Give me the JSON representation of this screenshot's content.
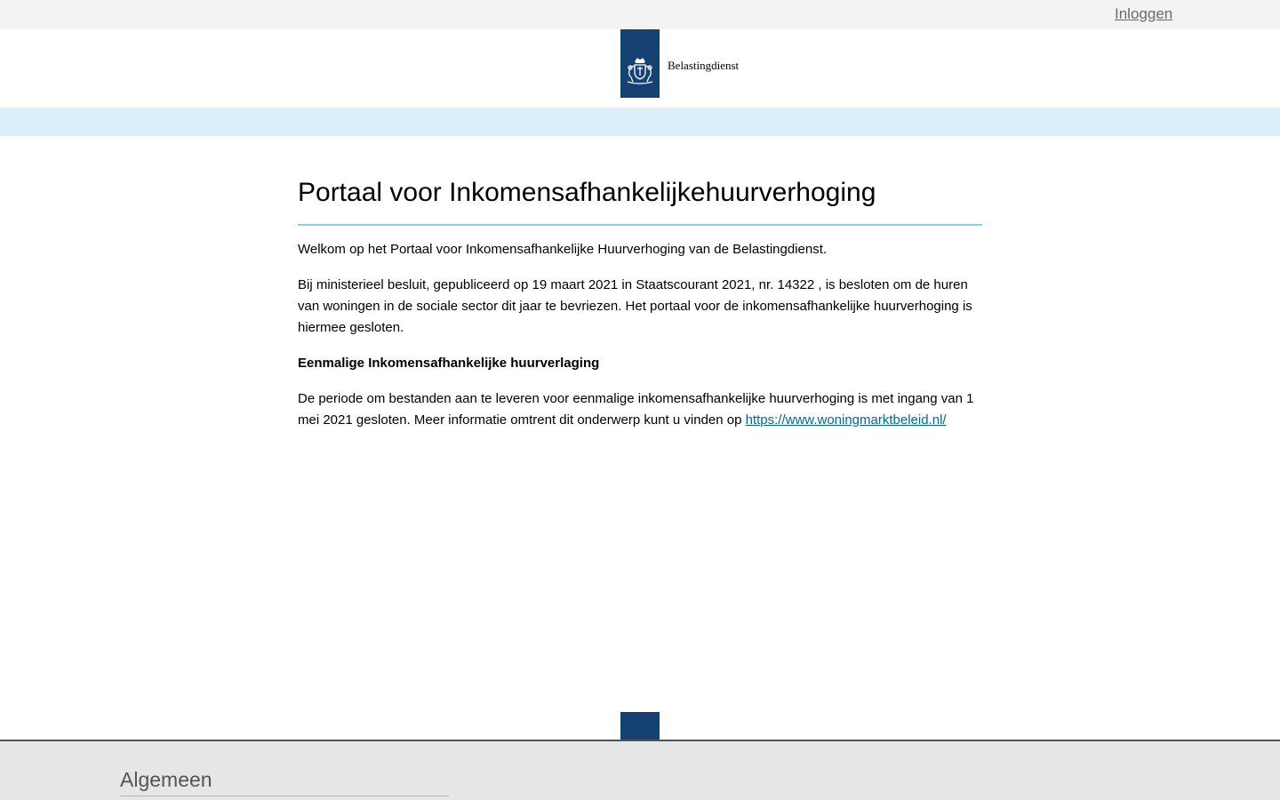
{
  "header": {
    "login_label": "Inloggen",
    "logo_text": "Belastingdienst",
    "logo_icon": "coat-of-arms-icon"
  },
  "main": {
    "title": "Portaal voor Inkomensafhankelijkehuurverhoging",
    "welcome_text": "Welkom op het Portaal voor Inkomensafhankelijke Huurverhoging van de Belastingdienst.",
    "decision_text": "Bij ministerieel besluit, gepubliceerd op 19 maart 2021 in Staatscourant 2021, nr. 14322 , is besloten om de huren van woningen in de sociale sector dit jaar te bevriezen. Het portaal voor de inkomensafhankelijke huurverhoging is hiermee gesloten.",
    "subheading": "Eenmalige Inkomensafhankelijke huurverlaging",
    "period_text": "De periode om bestanden aan te leveren voor eenmalige inkomensafhankelijke huurverhoging is met ingang van 1 mei 2021 gesloten. Meer informatie omtrent dit onderwerp kunt u vinden op ",
    "link_text": "https://www.woningmarktbeleid.nl/"
  },
  "footer": {
    "heading": "Algemeen"
  },
  "colors": {
    "brand_blue": "#154273",
    "band_light_blue": "#ddeff8",
    "title_rule": "#8fcae7",
    "link": "#01689b",
    "topbar": "#f3f3f3",
    "footer_bg": "#e6e6e6"
  }
}
